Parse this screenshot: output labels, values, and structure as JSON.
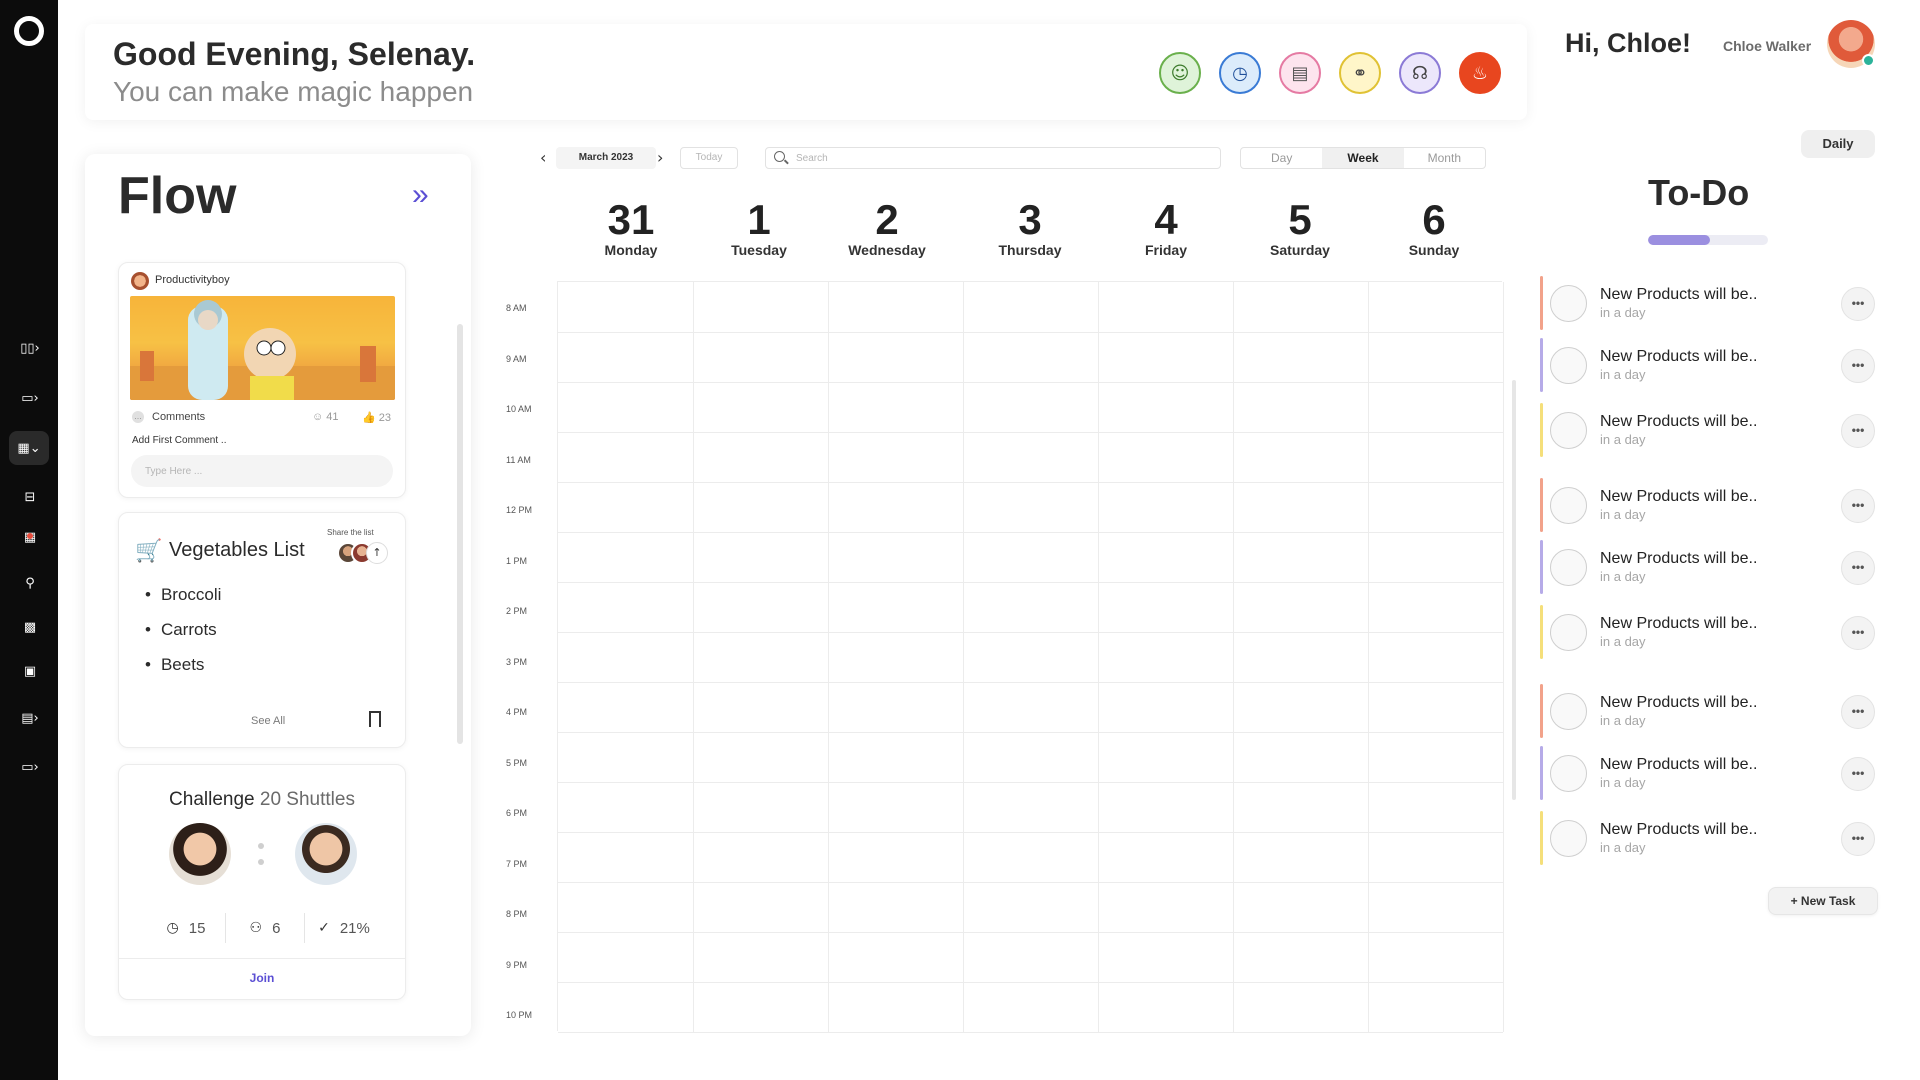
{
  "header": {
    "greeting": "Good Evening, Selenay.",
    "subtitle": "You can make magic happen",
    "icons": [
      {
        "name": "frog-icon",
        "glyph": "☺",
        "bg": "#dff3d9",
        "border": "#6ab04c",
        "color": "#3b7a2a"
      },
      {
        "name": "clock-icon",
        "glyph": "◷",
        "bg": "#dcecfb",
        "border": "#3a7bd5",
        "color": "#1f4f9a"
      },
      {
        "name": "document-icon",
        "glyph": "▤",
        "bg": "#fde4ee",
        "border": "#e57aa3",
        "color": "#555555"
      },
      {
        "name": "link-icon",
        "glyph": "⚭",
        "bg": "#fff6c9",
        "border": "#e0c234",
        "color": "#444444"
      },
      {
        "name": "head-chat-icon",
        "glyph": "☊",
        "bg": "#ece7fb",
        "border": "#8b7ad6",
        "color": "#444444"
      },
      {
        "name": "flame-icon",
        "glyph": "♨",
        "bg": "#e8461f",
        "border": "#e8461f",
        "color": "#ffffff"
      }
    ]
  },
  "user": {
    "greeting": "Hi, Chloe!",
    "name": "Chloe Walker"
  },
  "flow": {
    "title": "Flow",
    "post": {
      "username": "Productivityboy",
      "comments_label": "Comments",
      "reaction_count": "41",
      "like_count": "23",
      "add_comment": "Add First Comment ..",
      "input_placeholder": "Type Here ..."
    },
    "vegetables": {
      "title": "Vegetables List",
      "share_label": "Share the list",
      "items": [
        "Broccoli",
        "Carrots",
        "Beets"
      ],
      "see_all": "See All"
    },
    "challenge": {
      "title": "Challenge",
      "count_label": "20 Shuttles",
      "stats": {
        "time": "15",
        "people": "6",
        "done": "21%"
      },
      "join_label": "Join"
    }
  },
  "calendar": {
    "month_label": "March 2023",
    "today_label": "Today",
    "search_placeholder": "Search",
    "views": [
      "Day",
      "Week",
      "Month"
    ],
    "active_view": "Week",
    "days": [
      {
        "num": "31",
        "name": "Monday"
      },
      {
        "num": "1",
        "name": "Tuesday"
      },
      {
        "num": "2",
        "name": "Wednesday"
      },
      {
        "num": "3",
        "name": "Thursday"
      },
      {
        "num": "4",
        "name": "Friday"
      },
      {
        "num": "5",
        "name": "Saturday"
      },
      {
        "num": "6",
        "name": "Sunday"
      }
    ],
    "times": [
      "8 AM",
      "9 AM",
      "10 AM",
      "11 AM",
      "12 PM",
      "1 PM",
      "2 PM",
      "3 PM",
      "4 PM",
      "5 PM",
      "6 PM",
      "7 PM",
      "8 PM",
      "9 PM",
      "10 PM"
    ]
  },
  "todo": {
    "daily_label": "Daily",
    "title": "To-Do",
    "progress": 0.52,
    "tasks": [
      {
        "title": "New Products will be..",
        "sub": "in a day",
        "color": "#f2a28a"
      },
      {
        "title": "New Products will be..",
        "sub": "in a day",
        "color": "#b6abe8"
      },
      {
        "title": "New Products will be..",
        "sub": "in a day",
        "color": "#f5df7a"
      },
      {
        "title": "New Products will be..",
        "sub": "in a day",
        "color": "#f2a28a"
      },
      {
        "title": "New Products will be..",
        "sub": "in a day",
        "color": "#b6abe8"
      },
      {
        "title": "New Products will be..",
        "sub": "in a day",
        "color": "#f5df7a"
      },
      {
        "title": "New Products will be..",
        "sub": "in a day",
        "color": "#f2a28a"
      },
      {
        "title": "New Products will be..",
        "sub": "in a day",
        "color": "#b6abe8"
      },
      {
        "title": "New Products will be..",
        "sub": "in a day",
        "color": "#f5df7a"
      }
    ],
    "new_task_label": "+ New Task",
    "menu_glyph": "•••"
  },
  "rail": {
    "icons": [
      "book-icon",
      "store-icon",
      "calendar-icon",
      "bed-icon",
      "calendar-edit-icon",
      "user-search-icon",
      "qr-code-icon",
      "calendar-simple-icon",
      "news-icon",
      "chat-icon"
    ]
  }
}
